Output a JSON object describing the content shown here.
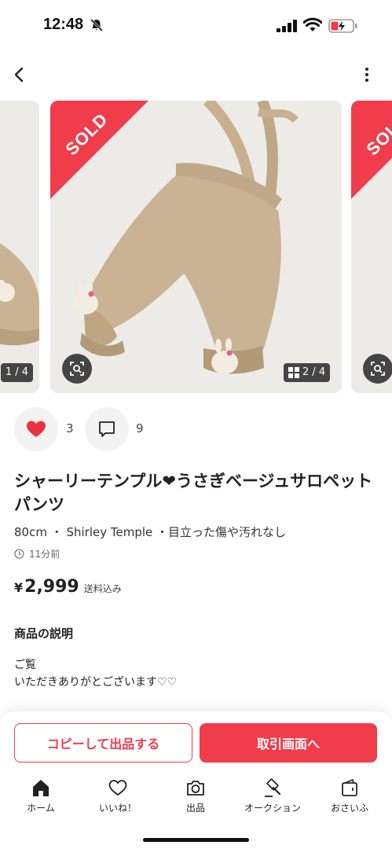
{
  "status_bar": {
    "time": "12:48"
  },
  "carousel": {
    "sold_label": "SOLD",
    "prev_counter": "1 / 4",
    "counter": "2 / 4"
  },
  "actions": {
    "like_count": "3",
    "comment_count": "9"
  },
  "item": {
    "title": "シャーリーテンプル❤︎うさぎベージュサロペットパンツ",
    "meta": "80cm ・ Shirley Temple ・目立った傷や汚れなし",
    "posted": "11分前",
    "currency": "¥",
    "price": "2,999",
    "shipping": "送料込み"
  },
  "description": {
    "heading": "商品の説明",
    "line1": "ご覧",
    "line2": "いただきありがとございます♡♡"
  },
  "buttons": {
    "copy_label": "コピーして出品する",
    "trade_label": "取引画面へ"
  },
  "tabs": {
    "home": "ホーム",
    "like": "いいね！",
    "sell": "出品",
    "auction": "オークション",
    "wallet": "おさいふ"
  },
  "colors": {
    "accent": "#f03c4b",
    "sold_ribbon": "#f03c4b",
    "heart": "#e8323f"
  }
}
